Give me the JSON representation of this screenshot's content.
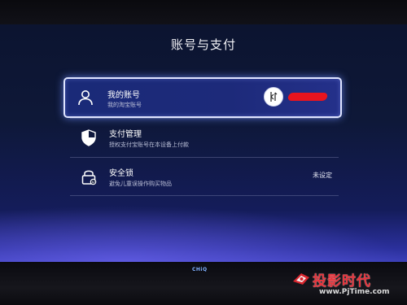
{
  "page": {
    "title": "账号与支付"
  },
  "items": [
    {
      "title": "我的账号",
      "subtitle": "我的淘宝账号",
      "icon": "user-icon",
      "focused": true
    },
    {
      "title": "支付管理",
      "subtitle": "授权支付宝账号在本设备上付款",
      "icon": "shield-icon"
    },
    {
      "title": "安全锁",
      "subtitle": "避免儿童误操作购买物品",
      "icon": "lock-icon",
      "value": "未设定"
    }
  ],
  "device": {
    "brand": "CHiQ"
  },
  "watermark": {
    "title": "投影时代",
    "url": "www.PjTime.com"
  },
  "colors": {
    "focus_border": "#dfe4ff",
    "background": "#0e1838",
    "redaction": "#e8141e"
  }
}
